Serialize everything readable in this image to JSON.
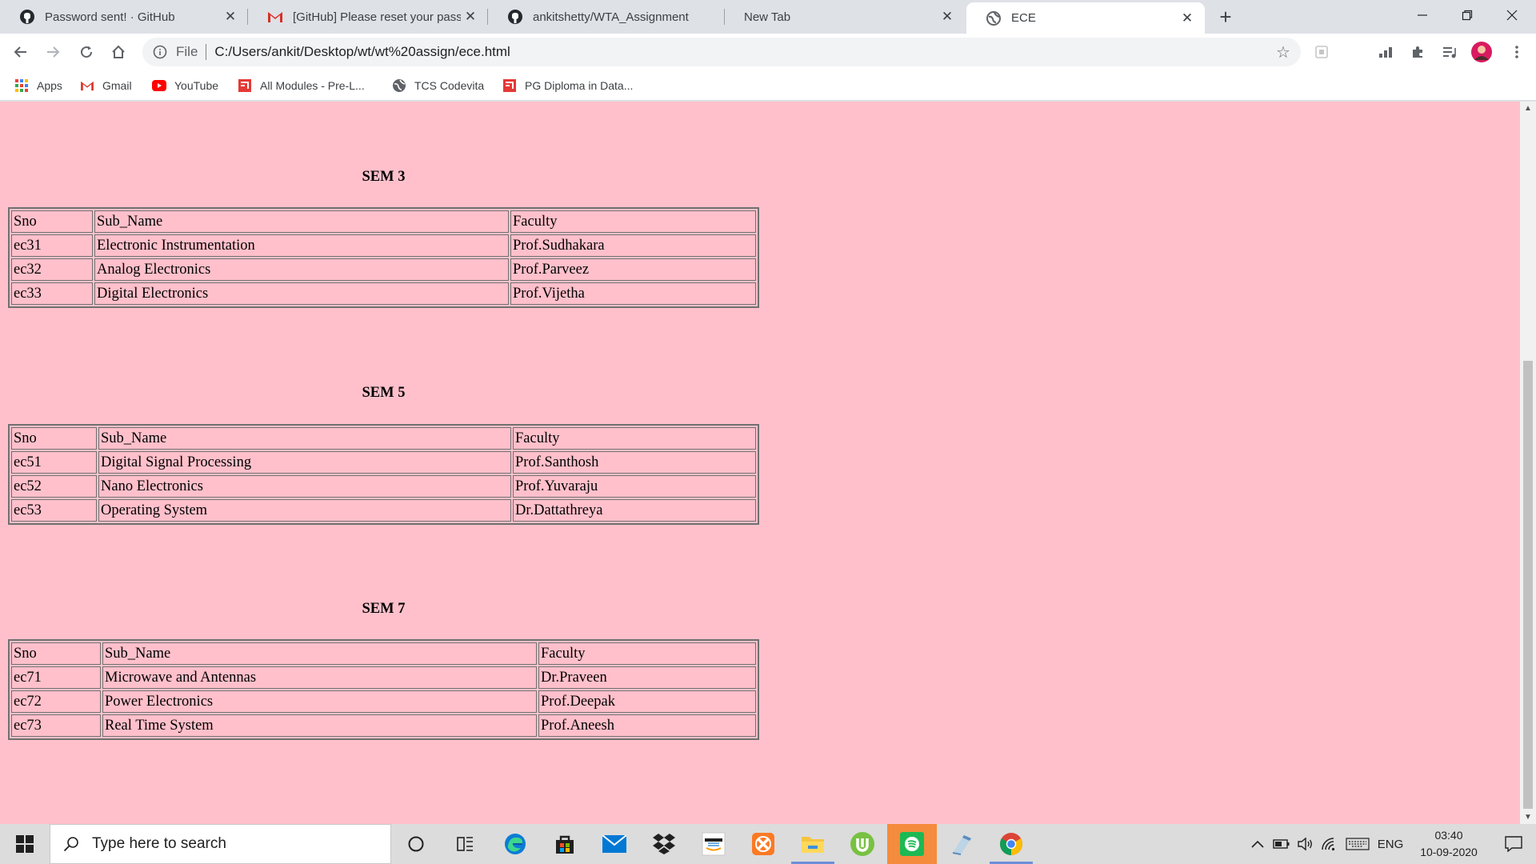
{
  "browser": {
    "tabs": [
      {
        "title": "Password sent! · GitHub",
        "icon": "github-icon"
      },
      {
        "title": "[GitHub] Please reset your passw",
        "icon": "gmail-icon"
      },
      {
        "title": "ankitshetty/WTA_Assignment",
        "icon": "github-icon"
      },
      {
        "title": "New Tab",
        "icon": ""
      },
      {
        "title": "ECE",
        "icon": "globe-icon"
      }
    ],
    "active_tab": 4,
    "address": {
      "scheme_label": "File",
      "url": "C:/Users/ankit/Desktop/wt/wt%20assign/ece.html"
    },
    "bookmarks": [
      {
        "label": "Apps",
        "icon": "apps-grid-icon"
      },
      {
        "label": "Gmail",
        "icon": "gmail-icon"
      },
      {
        "label": "YouTube",
        "icon": "youtube-icon"
      },
      {
        "label": "All Modules - Pre-L...",
        "icon": "module-icon"
      },
      {
        "label": "TCS Codevita",
        "icon": "globe-icon"
      },
      {
        "label": "PG Diploma in Data...",
        "icon": "module-icon"
      }
    ]
  },
  "page": {
    "background_color": "#ffc0cb",
    "sections": [
      {
        "heading": "SEM 3",
        "header": [
          "Sno",
          "Sub_Name",
          "Faculty"
        ],
        "rows": [
          [
            "ec31",
            "Electronic Instrumentation",
            "Prof.Sudhakara"
          ],
          [
            "ec32",
            "Analog Electronics",
            "Prof.Parveez"
          ],
          [
            "ec33",
            "Digital Electronics",
            "Prof.Vijetha"
          ]
        ]
      },
      {
        "heading": "SEM 5",
        "header": [
          "Sno",
          "Sub_Name",
          "Faculty"
        ],
        "rows": [
          [
            "ec51",
            "Digital Signal Processing",
            "Prof.Santhosh"
          ],
          [
            "ec52",
            "Nano Electronics",
            "Prof.Yuvaraju"
          ],
          [
            "ec53",
            "Operating System",
            "Dr.Dattathreya"
          ]
        ]
      },
      {
        "heading": "SEM 7",
        "header": [
          "Sno",
          "Sub_Name",
          "Faculty"
        ],
        "rows": [
          [
            "ec71",
            "Microwave and Antennas",
            "Dr.Praveen"
          ],
          [
            "ec72",
            "Power Electronics",
            "Prof.Deepak"
          ],
          [
            "ec73",
            "Real Time System",
            "Prof.Aneesh"
          ]
        ]
      }
    ]
  },
  "taskbar": {
    "search_placeholder": "Type here to search",
    "apps": [
      "cortana-icon",
      "task-view-icon",
      "edge-icon",
      "store-icon",
      "mail-icon",
      "dropbox-icon",
      "amazon-icon",
      "xampp-icon",
      "file-explorer-icon",
      "utorrent-icon",
      "spotify-icon",
      "notepad-icon",
      "chrome-icon"
    ],
    "tray": {
      "language": "ENG",
      "time": "03:40",
      "date": "10-09-2020"
    }
  }
}
